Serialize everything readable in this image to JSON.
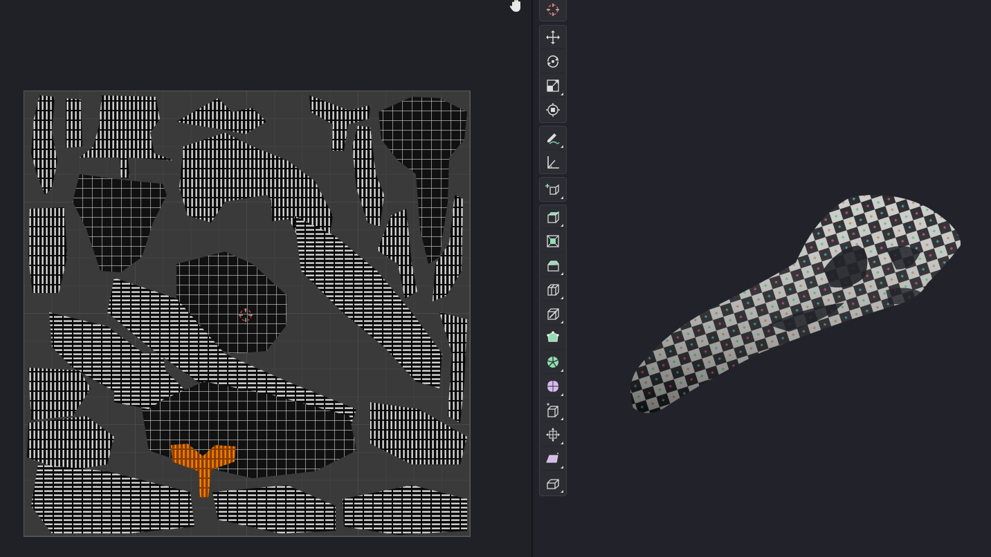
{
  "colors": {
    "uv_background": "#202126",
    "uv_grid": "#3a3a3a",
    "island_fill": "#0a0a0a",
    "island_edge": "#e8e8e8",
    "selected_island": "#ff8a00",
    "viewport_background": "#22232a",
    "toolbar_button": "#2c2d33",
    "add_tool_green": "#8fe0b0",
    "add_tool_purple": "#d8b8f0"
  },
  "icons": {
    "pan": "hand-icon",
    "uv_cursor": "2d-cursor-icon",
    "tools": [
      "cursor-icon",
      "move-icon",
      "rotate-icon",
      "scale-icon",
      "transform-icon",
      "annotate-icon",
      "measure-icon",
      "add-cube-icon",
      "extrude-region-icon",
      "inset-faces-icon",
      "bevel-icon",
      "loop-cut-icon",
      "knife-icon",
      "poly-build-icon",
      "spin-icon",
      "smooth-icon",
      "edge-slide-icon",
      "shrink-fatten-icon",
      "shear-icon",
      "rip-region-icon"
    ]
  }
}
